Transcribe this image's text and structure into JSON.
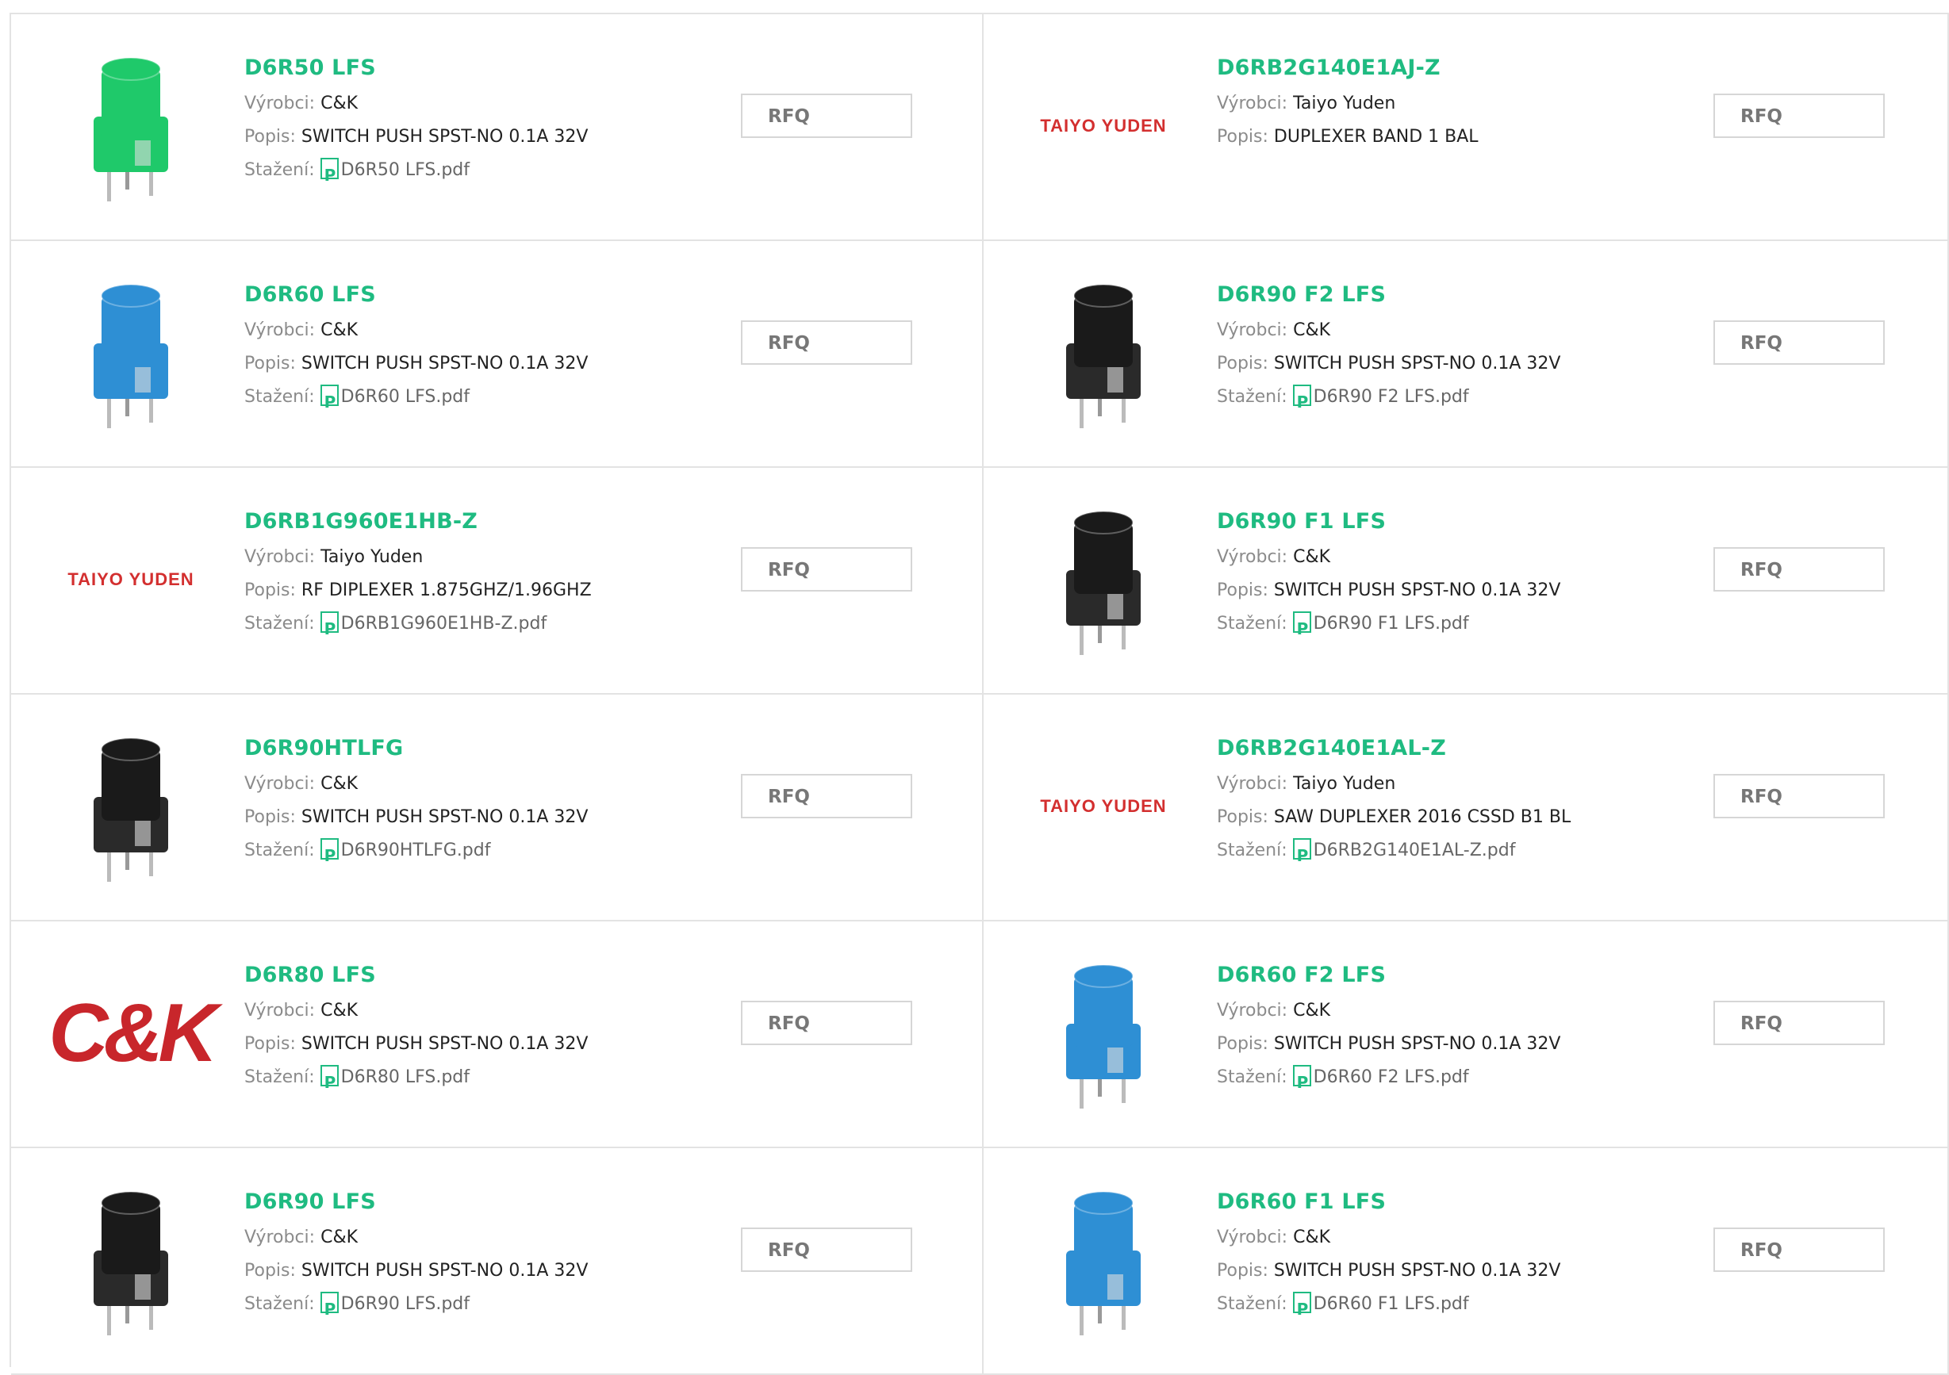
{
  "labels": {
    "vyrobci": "Výrobci:",
    "popis": "Popis:",
    "stazeni": "Stažení:",
    "rfq": "RFQ"
  },
  "products": [
    {
      "name": "D6R50 LFS",
      "manufacturer": "C&K",
      "description": "SWITCH PUSH SPST-NO 0.1A 32V",
      "download": "D6R50 LFS.pdf",
      "image": "switch-green",
      "cap_color": "#1fc96a"
    },
    {
      "name": "D6RB2G140E1AJ-Z",
      "manufacturer": "Taiyo Yuden",
      "description": "DUPLEXER BAND 1 BAL",
      "download": "",
      "image": "taiyo-yuden-logo",
      "logo_text": "TAIYO YUDEN"
    },
    {
      "name": "D6R60 LFS",
      "manufacturer": "C&K",
      "description": "SWITCH PUSH SPST-NO 0.1A 32V",
      "download": "D6R60 LFS.pdf",
      "image": "switch-blue",
      "cap_color": "#2e8fd4"
    },
    {
      "name": "D6R90 F2 LFS",
      "manufacturer": "C&K",
      "description": "SWITCH PUSH SPST-NO 0.1A 32V",
      "download": "D6R90 F2 LFS.pdf",
      "image": "switch-black",
      "cap_color": "#1a1a1a"
    },
    {
      "name": "D6RB1G960E1HB-Z",
      "manufacturer": "Taiyo Yuden",
      "description": "RF DIPLEXER 1.875GHZ/1.96GHZ",
      "download": "D6RB1G960E1HB-Z.pdf",
      "image": "taiyo-yuden-logo",
      "logo_text": "TAIYO YUDEN"
    },
    {
      "name": "D6R90 F1 LFS",
      "manufacturer": "C&K",
      "description": "SWITCH PUSH SPST-NO 0.1A 32V",
      "download": "D6R90 F1 LFS.pdf",
      "image": "switch-black",
      "cap_color": "#1a1a1a"
    },
    {
      "name": "D6R90HTLFG",
      "manufacturer": "C&K",
      "description": "SWITCH PUSH SPST-NO 0.1A 32V",
      "download": "D6R90HTLFG.pdf",
      "image": "switch-black",
      "cap_color": "#1a1a1a"
    },
    {
      "name": "D6RB2G140E1AL-Z",
      "manufacturer": "Taiyo Yuden",
      "description": "SAW DUPLEXER 2016 CSSD B1 BL",
      "download": "D6RB2G140E1AL-Z.pdf",
      "image": "taiyo-yuden-logo",
      "logo_text": "TAIYO YUDEN"
    },
    {
      "name": "D6R80 LFS",
      "manufacturer": "C&K",
      "description": "SWITCH PUSH SPST-NO 0.1A 32V",
      "download": "D6R80 LFS.pdf",
      "image": "ck-logo",
      "logo_text": "C&K"
    },
    {
      "name": "D6R60 F2 LFS",
      "manufacturer": "C&K",
      "description": "SWITCH PUSH SPST-NO 0.1A 32V",
      "download": "D6R60 F2 LFS.pdf",
      "image": "switch-blue",
      "cap_color": "#2e8fd4"
    },
    {
      "name": "D6R90 LFS",
      "manufacturer": "C&K",
      "description": "SWITCH PUSH SPST-NO 0.1A 32V",
      "download": "D6R90 LFS.pdf",
      "image": "switch-black",
      "cap_color": "#1a1a1a"
    },
    {
      "name": "D6R60 F1 LFS",
      "manufacturer": "C&K",
      "description": "SWITCH PUSH SPST-NO 0.1A 32V",
      "download": "D6R60 F1 LFS.pdf",
      "image": "switch-blue",
      "cap_color": "#2e8fd4"
    }
  ]
}
